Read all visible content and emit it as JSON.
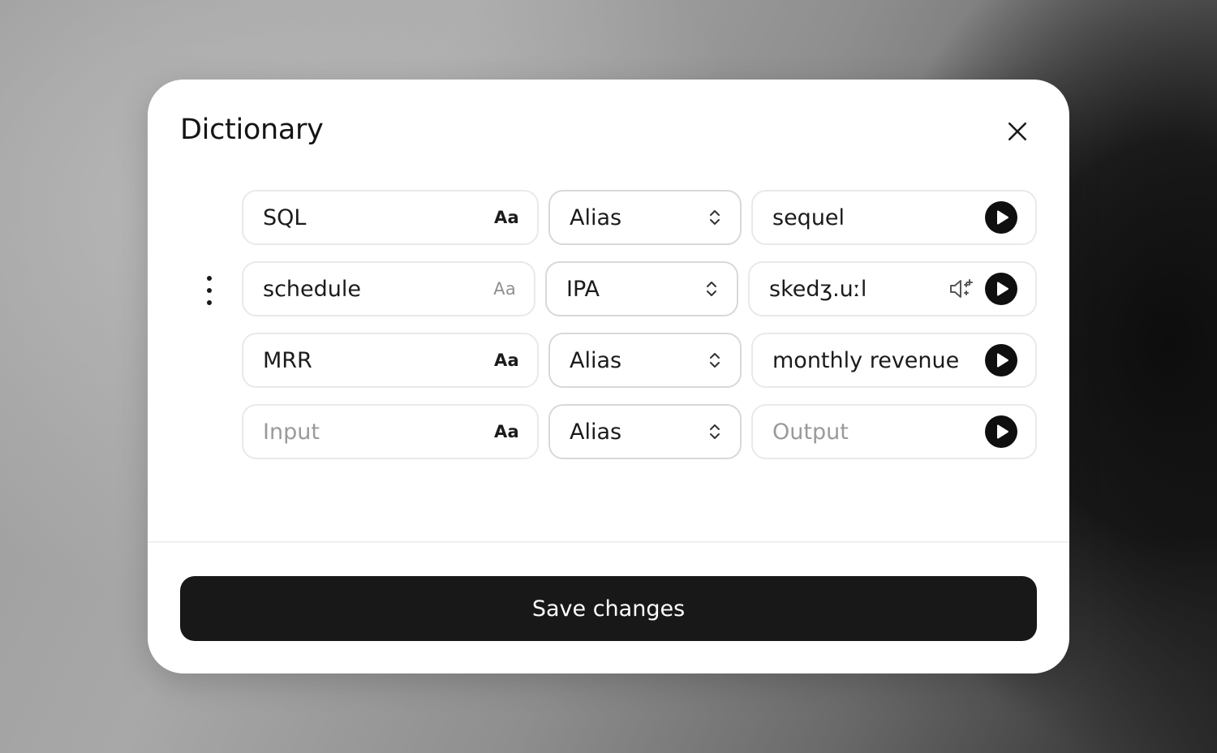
{
  "dialog": {
    "title": "Dictionary",
    "save_label": "Save changes"
  },
  "case_icon_label": "Aa",
  "rows": [
    {
      "input": "SQL",
      "type": "Alias",
      "output": "sequel"
    },
    {
      "input": "schedule",
      "type": "IPA",
      "output": "skedʒ.uːl"
    },
    {
      "input": "MRR",
      "type": "Alias",
      "output": "monthly revenue"
    }
  ],
  "new_row": {
    "input_placeholder": "Input",
    "type": "Alias",
    "output_placeholder": "Output"
  },
  "icons": {
    "close": "close-icon",
    "more": "more-vertical-icon",
    "select": "chevron-up-down-icon",
    "play": "play-icon",
    "voice": "speaker-sparkle-icon"
  }
}
